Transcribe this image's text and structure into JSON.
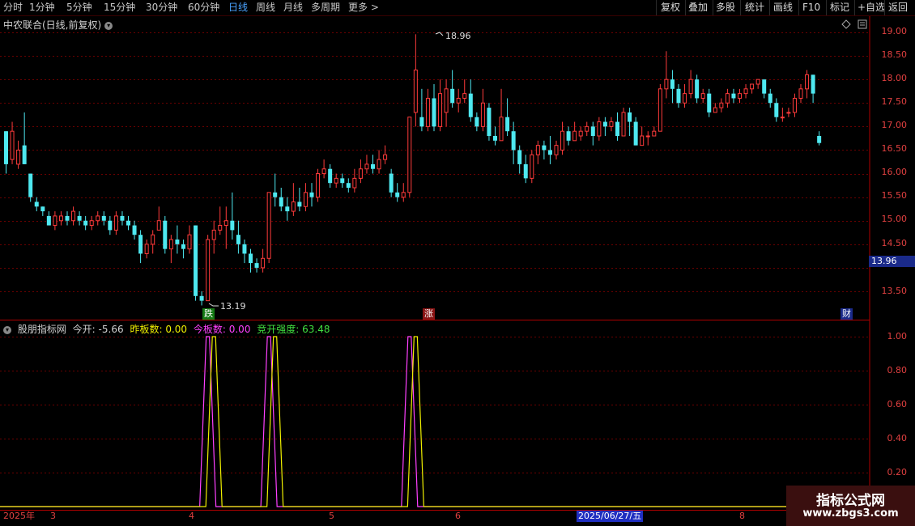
{
  "toolbar": {
    "timeframes": [
      "分时",
      "1分钟",
      "5分钟",
      "15分钟",
      "30分钟",
      "60分钟",
      "日线",
      "周线",
      "月线",
      "多周期",
      "更多 >"
    ],
    "active_timeframe": "日线",
    "buttons": [
      "复权",
      "叠加",
      "多股",
      "统计",
      "画线",
      "F10",
      "标记",
      "+自选",
      "返回"
    ]
  },
  "chart_title": "中农联合(日线,前复权)",
  "price_axis_ticks": [
    "19.00",
    "18.50",
    "18.00",
    "17.50",
    "17.00",
    "16.50",
    "16.00",
    "15.50",
    "15.00",
    "14.50",
    "13.50"
  ],
  "current_price_tag": "13.96",
  "annotations": {
    "high": "18.96",
    "low": "13.19"
  },
  "signals": {
    "down": "跌",
    "up": "涨",
    "finance": "财"
  },
  "indicator": {
    "name": "股朋指标网",
    "today_open": {
      "label": "今开:",
      "value": "-5.66"
    },
    "yesterday_limit": {
      "label": "昨板数:",
      "value": "0.00"
    },
    "today_limit": {
      "label": "今板数:",
      "value": "0.00"
    },
    "auction_strength": {
      "label": "竞开强度:",
      "value": "63.48"
    },
    "ticks": [
      "1.00",
      "0.80",
      "0.60",
      "0.40",
      "0.20"
    ]
  },
  "time_axis": {
    "labels": [
      "2025年",
      "3",
      "4",
      "5",
      "6",
      "8"
    ],
    "cursor_date": "2025/06/27/五"
  },
  "watermark": {
    "line1": "指标公式网",
    "line2": "www.zbgs3.com"
  },
  "colors": {
    "up": "#ff3b3b",
    "down": "#4ee8f0",
    "axis": "#b00000",
    "yesterday": "#f0f000",
    "today": "#ff40ff",
    "strength": "#40e040",
    "accent": "#4aa3ff"
  },
  "chart_data": {
    "type": "candlestick",
    "title": "中农联合(日线,前复权)",
    "ylim": [
      13.1,
      19.2
    ],
    "candles": [
      [
        16.9,
        16.2,
        16.9,
        16.0
      ],
      [
        16.3,
        16.9,
        17.1,
        16.2
      ],
      [
        16.2,
        16.5,
        16.7,
        16.1
      ],
      [
        16.6,
        16.2,
        17.3,
        16.2
      ],
      [
        16.0,
        15.5,
        16.0,
        15.4
      ],
      [
        15.4,
        15.3,
        15.5,
        15.2
      ],
      [
        15.3,
        15.2,
        15.3,
        15.1
      ],
      [
        15.1,
        14.9,
        15.2,
        14.9
      ],
      [
        14.9,
        15.1,
        15.2,
        14.8
      ],
      [
        15.0,
        15.1,
        15.2,
        14.9
      ],
      [
        15.1,
        15.0,
        15.2,
        14.9
      ],
      [
        15.0,
        15.2,
        15.3,
        14.9
      ],
      [
        15.1,
        15.0,
        15.2,
        14.9
      ],
      [
        15.0,
        14.9,
        15.1,
        14.8
      ],
      [
        14.9,
        15.0,
        15.1,
        14.8
      ],
      [
        15.0,
        15.1,
        15.2,
        14.9
      ],
      [
        15.1,
        15.0,
        15.2,
        14.9
      ],
      [
        15.0,
        14.8,
        15.1,
        14.7
      ],
      [
        14.8,
        15.1,
        15.2,
        14.7
      ],
      [
        15.1,
        15.0,
        15.2,
        14.9
      ],
      [
        15.0,
        14.9,
        15.1,
        14.8
      ],
      [
        14.9,
        14.7,
        15.0,
        14.6
      ],
      [
        14.7,
        14.3,
        14.8,
        14.1
      ],
      [
        14.3,
        14.5,
        14.6,
        14.2
      ],
      [
        14.5,
        14.7,
        14.8,
        14.3
      ],
      [
        14.8,
        15.0,
        15.3,
        14.8
      ],
      [
        15.0,
        14.4,
        15.1,
        14.3
      ],
      [
        14.4,
        14.6,
        14.7,
        14.1
      ],
      [
        14.6,
        14.5,
        14.9,
        14.3
      ],
      [
        14.5,
        14.4,
        14.6,
        14.2
      ],
      [
        14.4,
        14.7,
        14.9,
        14.3
      ],
      [
        14.9,
        13.4,
        14.9,
        13.3
      ],
      [
        13.4,
        13.3,
        13.5,
        13.2
      ],
      [
        13.3,
        14.6,
        14.7,
        13.3
      ],
      [
        14.6,
        14.8,
        15.0,
        14.3
      ],
      [
        14.8,
        14.9,
        15.3,
        14.7
      ],
      [
        14.9,
        15.0,
        15.3,
        14.4
      ],
      [
        15.0,
        14.8,
        15.6,
        14.6
      ],
      [
        14.7,
        14.5,
        15.0,
        14.3
      ],
      [
        14.5,
        14.3,
        14.6,
        14.1
      ],
      [
        14.3,
        14.1,
        14.4,
        13.9
      ],
      [
        14.1,
        14.0,
        14.2,
        13.9
      ],
      [
        14.0,
        14.2,
        14.4,
        13.9
      ],
      [
        14.2,
        15.6,
        15.6,
        14.1
      ],
      [
        15.6,
        15.5,
        16.0,
        15.3
      ],
      [
        15.5,
        15.3,
        15.7,
        15.2
      ],
      [
        15.3,
        15.2,
        15.5,
        15.0
      ],
      [
        15.2,
        15.4,
        15.8,
        15.1
      ],
      [
        15.4,
        15.3,
        15.7,
        15.2
      ],
      [
        15.3,
        15.6,
        15.8,
        15.2
      ],
      [
        15.6,
        15.5,
        15.8,
        15.3
      ],
      [
        15.5,
        16.0,
        16.1,
        15.4
      ],
      [
        16.0,
        16.1,
        16.3,
        15.9
      ],
      [
        16.1,
        15.8,
        16.2,
        15.7
      ],
      [
        15.8,
        15.9,
        16.0,
        15.7
      ],
      [
        15.9,
        15.8,
        16.0,
        15.7
      ],
      [
        15.8,
        15.7,
        15.9,
        15.6
      ],
      [
        15.7,
        15.9,
        16.1,
        15.6
      ],
      [
        15.9,
        16.1,
        16.3,
        15.8
      ],
      [
        16.1,
        16.2,
        16.4,
        16.0
      ],
      [
        16.2,
        16.1,
        16.4,
        16.0
      ],
      [
        16.1,
        16.3,
        16.5,
        16.0
      ],
      [
        16.3,
        16.4,
        16.6,
        16.2
      ],
      [
        16.0,
        15.6,
        16.1,
        15.5
      ],
      [
        15.6,
        15.5,
        15.8,
        15.4
      ],
      [
        15.5,
        15.6,
        15.8,
        15.4
      ],
      [
        15.6,
        17.2,
        17.2,
        15.5
      ],
      [
        17.3,
        18.2,
        18.96,
        17.0
      ],
      [
        17.2,
        17.0,
        17.8,
        16.9
      ],
      [
        17.0,
        17.6,
        17.8,
        16.9
      ],
      [
        17.6,
        17.0,
        17.9,
        16.9
      ],
      [
        17.0,
        17.7,
        18.0,
        16.9
      ],
      [
        17.3,
        17.8,
        18.0,
        17.0
      ],
      [
        17.8,
        17.5,
        18.2,
        17.4
      ],
      [
        17.5,
        17.6,
        17.8,
        17.3
      ],
      [
        17.6,
        17.7,
        18.0,
        17.5
      ],
      [
        17.7,
        17.2,
        18.0,
        17.1
      ],
      [
        17.2,
        17.0,
        17.3,
        16.9
      ],
      [
        17.0,
        17.5,
        17.8,
        16.9
      ],
      [
        17.4,
        16.8,
        17.5,
        16.7
      ],
      [
        16.8,
        16.7,
        17.0,
        16.6
      ],
      [
        16.7,
        17.2,
        17.8,
        16.7
      ],
      [
        17.2,
        16.9,
        17.6,
        16.8
      ],
      [
        16.9,
        16.5,
        17.1,
        16.2
      ],
      [
        16.5,
        16.2,
        16.6,
        16.0
      ],
      [
        16.2,
        15.9,
        16.4,
        15.8
      ],
      [
        15.9,
        16.4,
        16.5,
        15.8
      ],
      [
        16.4,
        16.6,
        16.7,
        16.2
      ],
      [
        16.6,
        16.5,
        16.7,
        16.3
      ],
      [
        16.5,
        16.4,
        16.8,
        16.2
      ],
      [
        16.4,
        16.6,
        16.7,
        16.3
      ],
      [
        16.5,
        16.9,
        17.1,
        16.4
      ],
      [
        16.9,
        16.7,
        17.0,
        16.6
      ],
      [
        16.7,
        16.9,
        17.1,
        16.8
      ],
      [
        16.8,
        16.9,
        17.0,
        16.7
      ],
      [
        16.9,
        17.0,
        17.1,
        16.8
      ],
      [
        17.0,
        16.8,
        17.1,
        16.6
      ],
      [
        16.8,
        17.1,
        17.2,
        16.7
      ],
      [
        17.1,
        17.0,
        17.2,
        16.8
      ],
      [
        17.0,
        17.1,
        17.2,
        16.9
      ],
      [
        17.1,
        16.8,
        17.3,
        16.7
      ],
      [
        16.8,
        17.3,
        17.4,
        16.8
      ],
      [
        17.3,
        17.1,
        17.4,
        16.8
      ],
      [
        17.1,
        16.6,
        17.2,
        16.6
      ],
      [
        16.6,
        16.8,
        17.0,
        16.6
      ],
      [
        16.8,
        16.8,
        16.9,
        16.6
      ],
      [
        16.8,
        16.9,
        17.0,
        16.8
      ],
      [
        16.9,
        17.8,
        17.9,
        16.9
      ],
      [
        17.8,
        18.0,
        18.6,
        17.6
      ],
      [
        18.0,
        17.8,
        18.2,
        17.5
      ],
      [
        17.8,
        17.5,
        17.9,
        17.4
      ],
      [
        17.5,
        17.7,
        17.9,
        17.4
      ],
      [
        17.7,
        18.0,
        18.2,
        17.6
      ],
      [
        18.0,
        17.6,
        18.1,
        17.5
      ],
      [
        17.6,
        17.7,
        17.8,
        17.5
      ],
      [
        17.7,
        17.3,
        17.8,
        17.2
      ],
      [
        17.3,
        17.4,
        17.5,
        17.3
      ],
      [
        17.4,
        17.5,
        17.6,
        17.3
      ],
      [
        17.5,
        17.7,
        17.8,
        17.4
      ],
      [
        17.7,
        17.6,
        17.8,
        17.5
      ],
      [
        17.6,
        17.7,
        17.8,
        17.5
      ],
      [
        17.7,
        17.8,
        17.9,
        17.6
      ],
      [
        17.8,
        17.9,
        17.9,
        17.7
      ],
      [
        17.9,
        18.0,
        18.0,
        17.8
      ],
      [
        18.0,
        17.7,
        18.0,
        17.6
      ],
      [
        17.7,
        17.5,
        17.8,
        17.4
      ],
      [
        17.5,
        17.2,
        17.6,
        17.1
      ],
      [
        17.2,
        17.2,
        17.4,
        17.1
      ],
      [
        17.3,
        17.3,
        17.4,
        17.2
      ],
      [
        17.3,
        17.6,
        17.7,
        17.2
      ],
      [
        17.6,
        17.8,
        17.9,
        17.5
      ],
      [
        17.8,
        18.1,
        18.2,
        17.6
      ],
      [
        18.1,
        17.7,
        18.1,
        17.5
      ],
      [
        16.8,
        16.65,
        16.9,
        16.6
      ]
    ],
    "indicator_series": {
      "ylim": [
        0,
        1.05
      ],
      "yesterday_limit_spikes": [
        34,
        44,
        67
      ],
      "today_limit_spikes": [
        33,
        43,
        66
      ]
    }
  }
}
